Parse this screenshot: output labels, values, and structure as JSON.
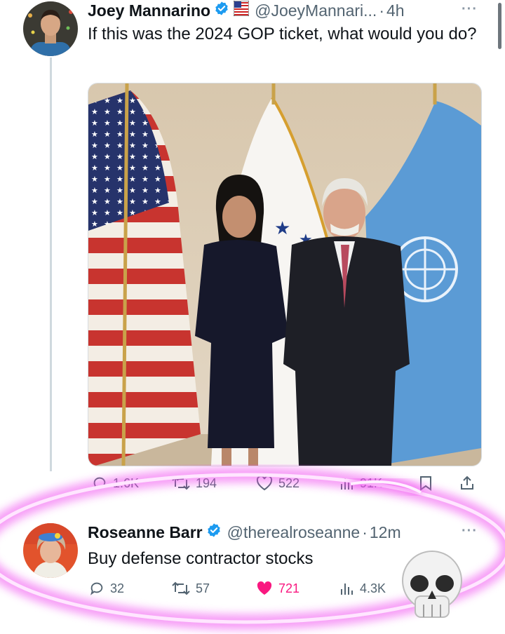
{
  "tweet1": {
    "display_name": "Joey Mannarino",
    "handle": "@JoeyMannari...",
    "time": "4h",
    "more": "···",
    "text": "If this was the 2024 GOP ticket, what would you do?",
    "stats": {
      "replies": "1.6K",
      "reposts": "194",
      "likes": "522",
      "views": "91K"
    }
  },
  "tweet2": {
    "display_name": "Roseanne Barr",
    "handle": "@therealroseanne",
    "time": "12m",
    "more": "···",
    "text": "Buy defense contractor stocks",
    "stats": {
      "replies": "32",
      "reposts": "57",
      "likes": "721",
      "views": "4.3K"
    }
  },
  "icons": {
    "verified": "verified-badge-icon",
    "reply": "reply-icon",
    "repost": "repost-icon",
    "like": "heart-icon",
    "views": "views-icon",
    "bookmark": "bookmark-icon",
    "share": "share-icon",
    "overlay": "skull-emoji"
  },
  "colors": {
    "verified_blue": "#1d9bf0",
    "like_red": "#f91880",
    "highlight_magenta": "#f04ef0",
    "secondary_text": "#536471"
  }
}
